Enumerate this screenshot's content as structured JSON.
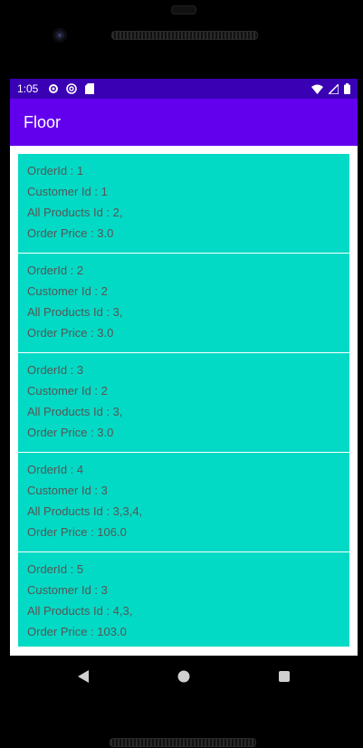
{
  "status_bar": {
    "time": "1:05",
    "icons_left": [
      "settings-icon",
      "at-sign-icon",
      "sd-card-icon"
    ],
    "icons_right": [
      "wifi-icon",
      "signal-icon",
      "battery-icon"
    ]
  },
  "app_bar": {
    "title": "Floor"
  },
  "orders": [
    {
      "order_id": "OrderId : 1",
      "customer_id": "Customer Id : 1",
      "products": "All Products Id : 2,",
      "price": "Order Price : 3.0"
    },
    {
      "order_id": "OrderId : 2",
      "customer_id": "Customer Id : 2",
      "products": "All Products Id : 3,",
      "price": "Order Price : 3.0"
    },
    {
      "order_id": "OrderId : 3",
      "customer_id": "Customer Id : 2",
      "products": "All Products Id : 3,",
      "price": "Order Price : 3.0"
    },
    {
      "order_id": "OrderId : 4",
      "customer_id": "Customer Id : 3",
      "products": "All Products Id : 3,3,4,",
      "price": "Order Price : 106.0"
    },
    {
      "order_id": "OrderId : 5",
      "customer_id": "Customer Id : 3",
      "products": "All Products Id : 4,3,",
      "price": "Order Price : 103.0"
    }
  ],
  "nav_bar": {
    "buttons": [
      "back-icon",
      "home-icon",
      "recents-icon"
    ]
  },
  "colors": {
    "status_bar": "#3a00b3",
    "app_bar": "#6200ee",
    "item_bg": "#03dac5"
  }
}
